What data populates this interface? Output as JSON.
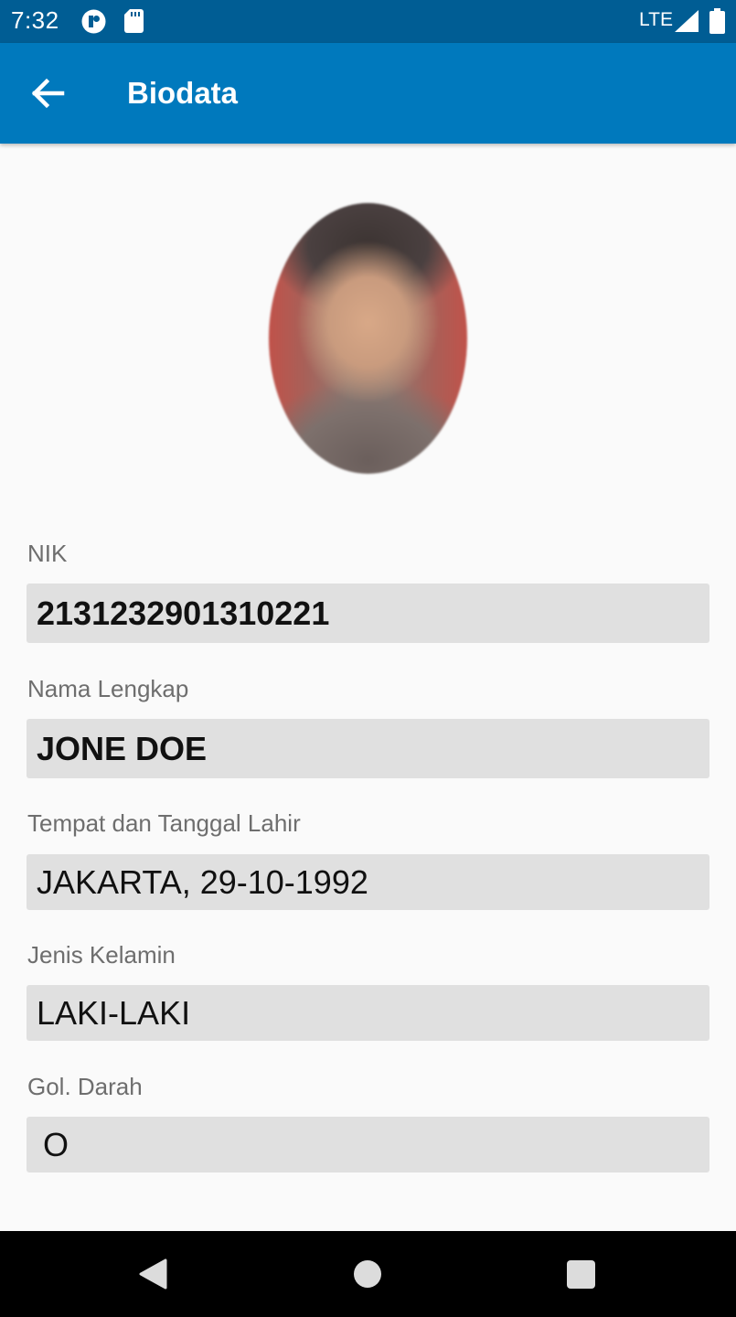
{
  "status_bar": {
    "time": "7:32",
    "network": "LTE",
    "icons": [
      "app-notification-icon",
      "sd-card-icon",
      "signal-icon",
      "battery-icon"
    ]
  },
  "app_bar": {
    "title": "Biodata",
    "back_icon": "arrow-left-icon",
    "color": "#0079bd"
  },
  "profile": {
    "photo": "profile-photo"
  },
  "fields": [
    {
      "label": "NIK",
      "value": "2131232901310221"
    },
    {
      "label": "Nama Lengkap",
      "value": "JONE DOE"
    },
    {
      "label": "Tempat dan Tanggal Lahir",
      "value": "JAKARTA, 29-10-1992"
    },
    {
      "label": "Jenis Kelamin",
      "value": "LAKI-LAKI"
    },
    {
      "label": "Gol. Darah",
      "value": "O"
    }
  ],
  "nav_bar": {
    "icons": [
      "nav-back-icon",
      "nav-home-icon",
      "nav-recents-icon"
    ]
  }
}
